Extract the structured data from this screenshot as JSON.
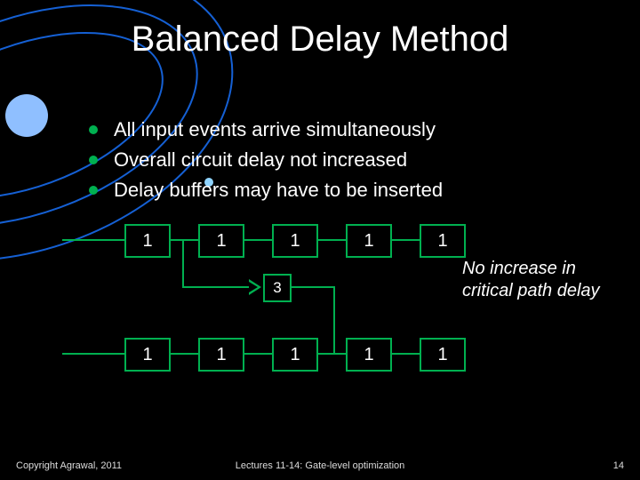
{
  "title": "Balanced Delay Method",
  "bullets": [
    "All input events arrive simultaneously",
    "Overall circuit delay not increased",
    "Delay buffers may have to be inserted"
  ],
  "diagram": {
    "topRow": [
      "1",
      "1",
      "1",
      "1",
      "1"
    ],
    "bottomRow": [
      "1",
      "1",
      "1",
      "1",
      "1"
    ],
    "buffer": "3"
  },
  "note": "No increase in critical path delay",
  "footer": {
    "left": "Copyright Agrawal, 2011",
    "center": "Lectures 11-14: Gate-level optimization",
    "right": "14"
  },
  "colors": {
    "accent": "#00b050"
  }
}
